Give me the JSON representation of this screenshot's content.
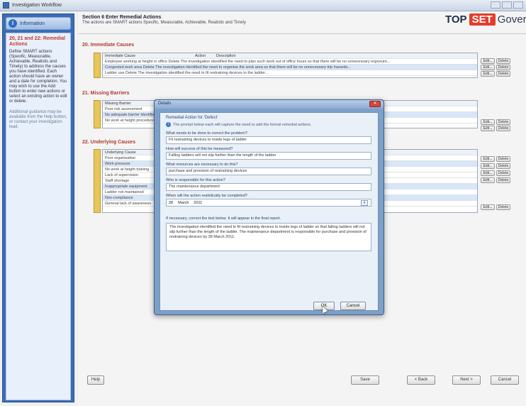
{
  "window": {
    "title": "Investigation Workflow"
  },
  "left": {
    "header": "Information",
    "title": "20, 21 and 22: Remedial Actions",
    "text": "Define SMART actions (Specific, Measurable, Achievable, Realistic and Timely) to address the causes you have identified. Each action should have an owner and a date for completion. You may wish to use the Add button to enter new actions or select an existing action to edit or delete.",
    "subtext": "Additional guidance may be available from the Help button, or contact your investigation lead."
  },
  "header": {
    "title": "Section 6 Enter Remedial Actions",
    "subtitle": "The actions are SMART actions Specific, Measurable, Achievable, Realistic and Timely",
    "logo_left": "TOP",
    "logo_mid": "SET",
    "logo_right": "Governor"
  },
  "sections": {
    "immediate": "20. Immediate Causes",
    "missing": "21. Missing Barriers",
    "underlying": "22. Underlying Causes"
  },
  "tables": {
    "immediate_headers": [
      "Immediate Cause",
      "Action",
      "Description"
    ],
    "immediate_rows": [
      "Employee working at height in office   Delete   The investigation identified the need to plan such work out of office hours so that there will be no unnecessary exposure...",
      "Congested work area   Delete   The investigation identified the need to organise the work area so that there will be no unnecessary trip hazards...",
      "Ladder use   Delete   The investigation identified the need to fit restraining devices to the ladder..."
    ],
    "missing_rows": [
      "Missing Barrier",
      "Poor risk assessment",
      "No adequate barrier identified",
      "No work at height procedure"
    ],
    "underlying_rows": [
      "Underlying Cause",
      "Poor organisation",
      "Work pressure",
      "No work at height training",
      "Lack of supervision",
      "Staff shortage",
      "Inappropriate equipment",
      "Ladder not maintained",
      "Non-compliance",
      "General lack of awareness"
    ],
    "edit_label": "Edit...",
    "delete_label": "Delete"
  },
  "footer": {
    "help": "Help",
    "save": "Save",
    "back": "< Back",
    "next": "Next >",
    "cancel": "Cancel"
  },
  "dialog": {
    "window_title": "Details",
    "title": "Remedial Action for 'Defect'",
    "note": "The prompt below each will capture the need to add the formal remedial actions.",
    "q1": "What needs to be done to correct the problem?",
    "a1": "Fit restraining devices to inside legs of ladder",
    "q2": "How will success of this be measured?",
    "a2": "Falling ladders will not slip further than the length of the ladder",
    "q3": "What resources are necessary to do this?",
    "a3": "purchase and provision of restraining devices",
    "q4": "Who is responsible for this action?",
    "a4": "The maintenance department",
    "q5": "When will the action realistically be completed?",
    "date_day": "28",
    "date_month": "March",
    "date_year": "2011",
    "q6": "If necessary, correct the text below. It will appear in the final report.",
    "summary": "The investigation identified the need to fit restraining devices to inside legs of ladder so that falling ladders will not slip further than the length of the ladder. The maintenance department is responsible for purchase and provision of restraining devices by 28 March 2011.",
    "ok": "OK",
    "cancel": "Cancel"
  }
}
